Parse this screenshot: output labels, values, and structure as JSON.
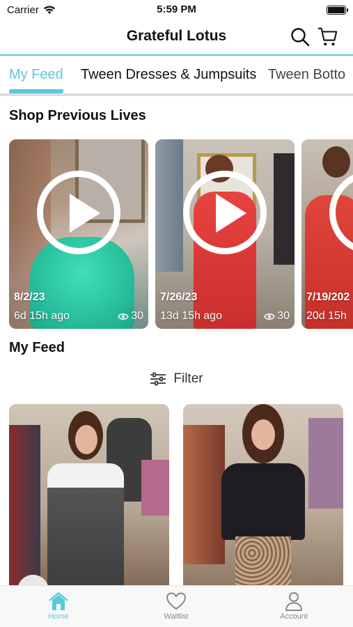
{
  "status": {
    "carrier": "Carrier",
    "time": "5:59 PM"
  },
  "header": {
    "title": "Grateful Lotus"
  },
  "tabs": [
    {
      "label": "My Feed",
      "active": true
    },
    {
      "label": "Tween Dresses & Jumpsuits",
      "active": false
    },
    {
      "label": "Tween Botto",
      "active": false
    }
  ],
  "previous_lives": {
    "title": "Shop Previous Lives",
    "items": [
      {
        "date": "8/2/23",
        "ago": "6d 15h ago",
        "views": "30"
      },
      {
        "date": "7/26/23",
        "ago": "13d 15h ago",
        "views": "30"
      },
      {
        "date": "7/19/202",
        "ago": "20d 15h",
        "views": ""
      }
    ]
  },
  "feed": {
    "title": "My Feed",
    "filter_label": "Filter"
  },
  "bottom_nav": [
    {
      "label": "Home",
      "icon": "home-icon",
      "active": true
    },
    {
      "label": "Waitlist",
      "icon": "heart-icon",
      "active": false
    },
    {
      "label": "Account",
      "icon": "person-icon",
      "active": false
    }
  ],
  "colors": {
    "accent": "#5cc9d9"
  }
}
